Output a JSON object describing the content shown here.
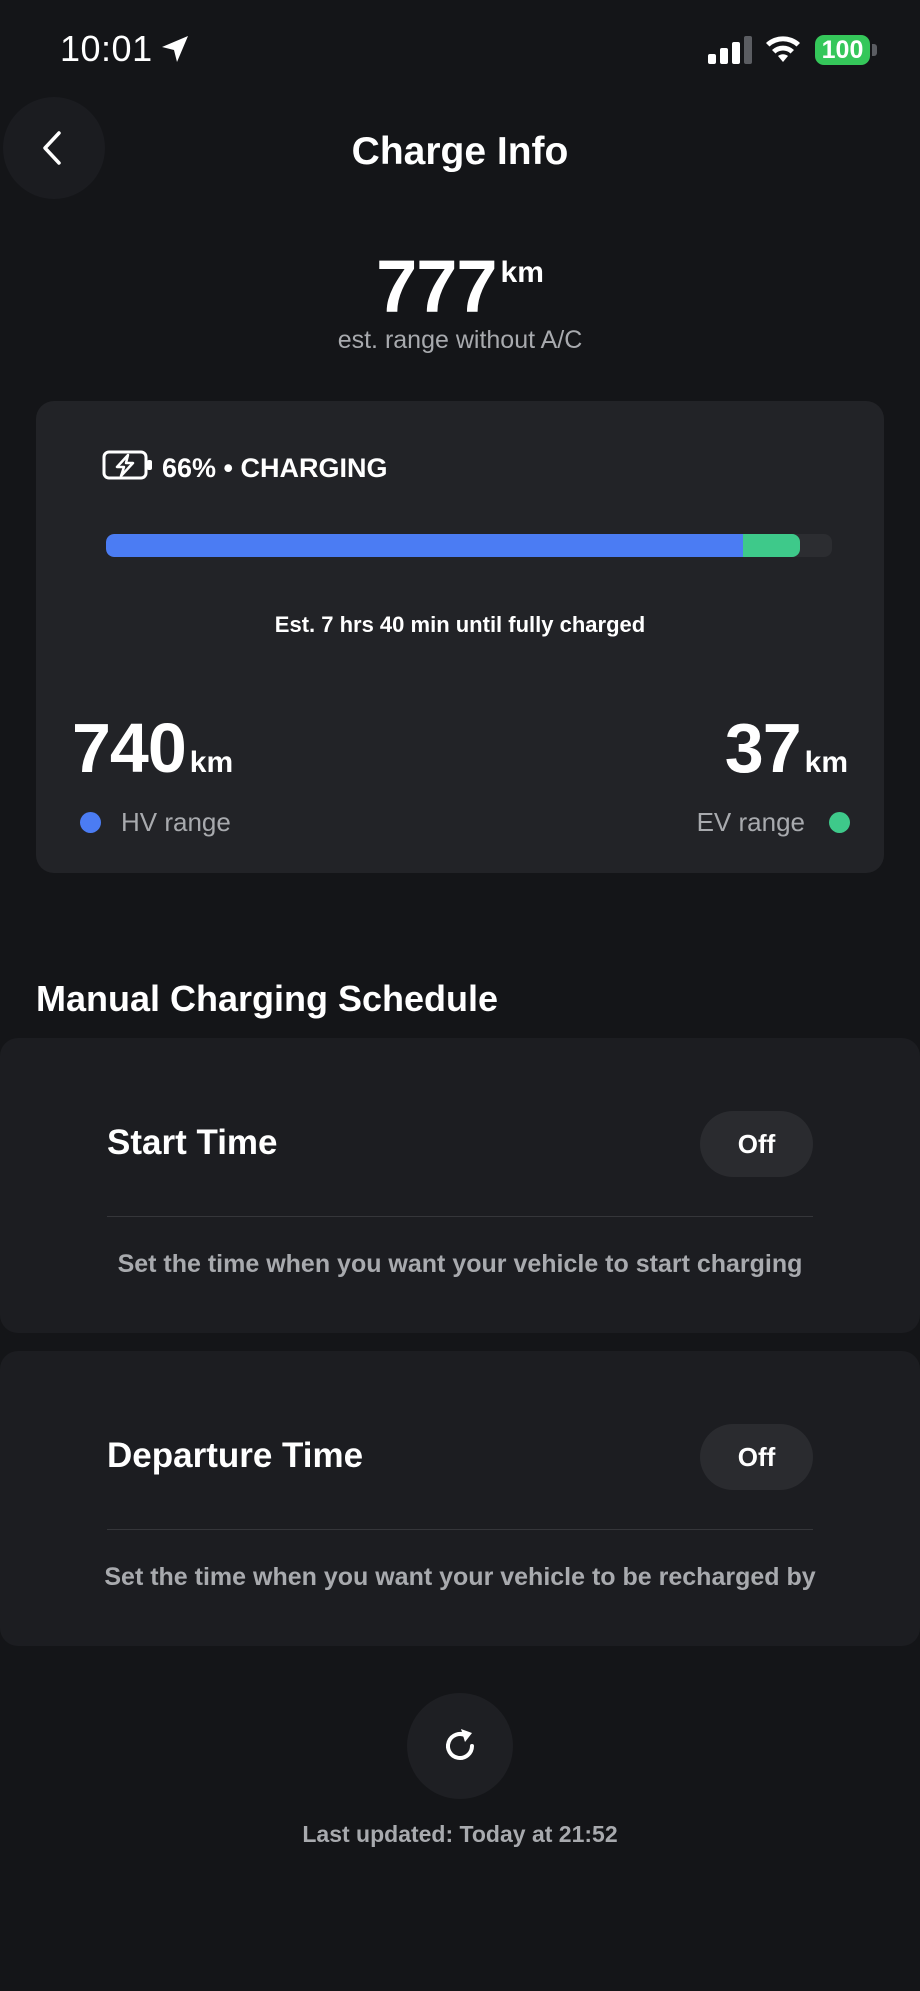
{
  "status_bar": {
    "time": "10:01",
    "battery_level": "100",
    "icons": [
      "location-arrow-icon",
      "cellular-signal-icon",
      "wifi-icon",
      "battery-icon"
    ]
  },
  "header": {
    "title": "Charge Info",
    "back_icon": "chevron-left-icon"
  },
  "range": {
    "value": "777",
    "unit": "km",
    "caption": "est. range without A/C"
  },
  "charge": {
    "status": "66% • CHARGING",
    "icon": "battery-bolt-icon",
    "hv_fraction": 0.878,
    "ev_fraction": 0.078,
    "eta_text": "Est. 7 hrs 40 min until fully charged",
    "hv_range": {
      "value": "740",
      "unit": "km",
      "label": "HV range"
    },
    "ev_range": {
      "value": "37",
      "unit": "km",
      "label": "EV range"
    },
    "colors": {
      "hv": "#4b7cf3",
      "ev": "#3ec98a",
      "track": "#2c2d31"
    }
  },
  "schedule": {
    "title": "Manual Charging Schedule",
    "start": {
      "title": "Start Time",
      "toggle": "Off",
      "description": "Set the time when you want your vehicle to start charging"
    },
    "departure": {
      "title": "Departure Time",
      "toggle": "Off",
      "description": "Set the time when you want your vehicle to be recharged by"
    }
  },
  "footer": {
    "refresh_icon": "refresh-icon",
    "last_updated": "Last updated:  Today at 21:52"
  }
}
